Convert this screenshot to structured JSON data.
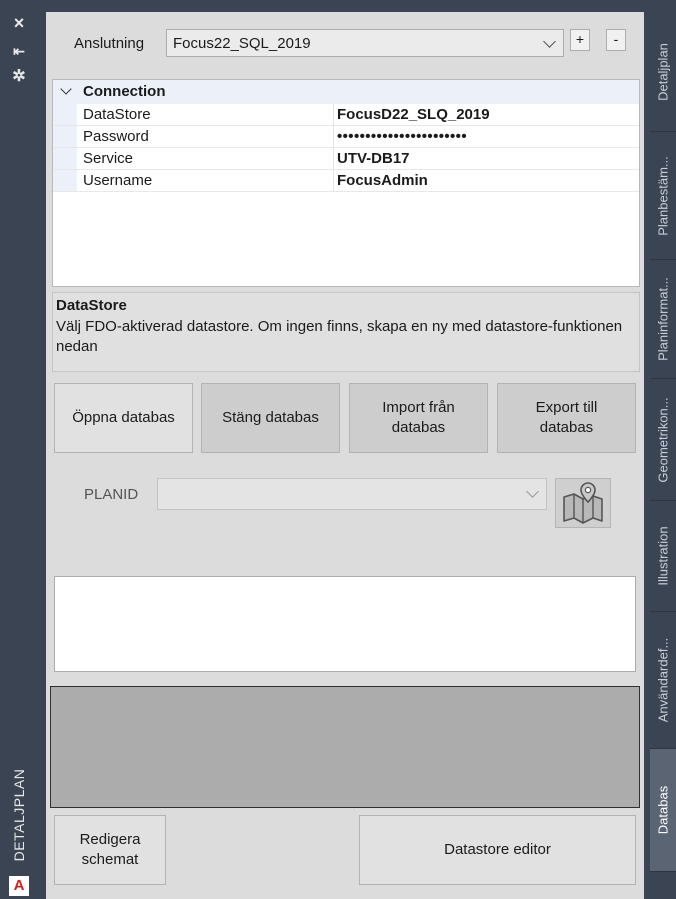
{
  "left_bar": {
    "close_glyph": "×",
    "autohide_glyph": "⇤",
    "settings_glyph": "✲",
    "palette_title": "DETALJPLAN",
    "app_logo": "A"
  },
  "connection": {
    "label": "Anslutning",
    "selected": "Focus22_SQL_2019",
    "add_label": "+",
    "remove_label": "-"
  },
  "properties": {
    "category": "Connection",
    "rows": [
      {
        "name": "DataStore",
        "value": "FocusD22_SLQ_2019"
      },
      {
        "name": "Password",
        "value": "•••••••••••••••••••••••"
      },
      {
        "name": "Service",
        "value": "UTV-DB17"
      },
      {
        "name": "Username",
        "value": "FocusAdmin"
      }
    ]
  },
  "description": {
    "title": "DataStore",
    "text": "Välj FDO-aktiverad datastore. Om ingen finns, skapa en ny med datastore-funktionen nedan"
  },
  "buttons": {
    "open": "Öppna databas",
    "close": "Stäng databas",
    "import": "Import från databas",
    "export": "Export till databas",
    "edit_schema": "Redigera schemat",
    "datastore_editor": "Datastore editor"
  },
  "planid": {
    "label": "PLANID",
    "value": ""
  },
  "right_tabs": [
    {
      "label": "Detaljplan",
      "active": false
    },
    {
      "label": "Planbestäm...",
      "active": false
    },
    {
      "label": "Planinformat...",
      "active": false
    },
    {
      "label": "Geometrikon...",
      "active": false
    },
    {
      "label": "Illustration",
      "active": false
    },
    {
      "label": "Användardef...",
      "active": false
    },
    {
      "label": "Databas",
      "active": true
    }
  ],
  "colors": {
    "frame": "#3b4453",
    "panel": "#dcdcdc",
    "active_tab": "#5a6473",
    "logo_red": "#d42020"
  }
}
